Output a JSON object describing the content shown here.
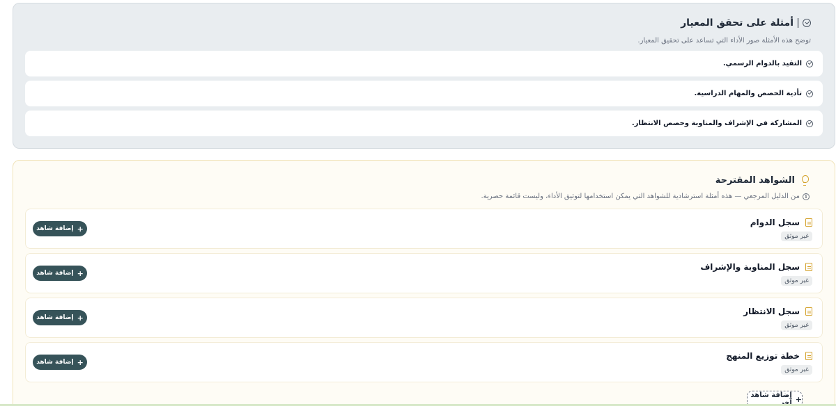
{
  "examples": {
    "title": "أمثلة على تحقق المعيار",
    "description": "توضح هذه الأمثلة صور الأداء التي تساعد على تحقيق المعيار.",
    "items": [
      {
        "label": "التقيد بالدوام الرسمي."
      },
      {
        "label": "تأدية الحصص والمهام الدراسية."
      },
      {
        "label": "المشاركة في الإشراف والمناوبة وحصص الانتظار."
      }
    ]
  },
  "evidence": {
    "title": "الشواهد المقترحة",
    "description": "من الدليل المرجعي — هذه أمثلة استرشادية للشواهد التي يمكن استخدامها لتوثيق الأداء، وليست قائمة حصرية.",
    "items": [
      {
        "name": "سجل الدوام",
        "status": "غير موثق",
        "button": "إضافة شاهد"
      },
      {
        "name": "سجل المناوبة والإشراف",
        "status": "غير موثق",
        "button": "إضافة شاهد"
      },
      {
        "name": "سجل الانتظار",
        "status": "غير موثق",
        "button": "إضافة شاهد"
      },
      {
        "name": "خطة توزيع المنهج",
        "status": "غير موثق",
        "button": "إضافة شاهد"
      }
    ],
    "add_other": "إضافة شاهد آخر"
  },
  "icons": {
    "check": "circle-check-icon",
    "bulb": "lightbulb-icon",
    "info": "info-icon",
    "doc": "document-icon",
    "plus": "plus-icon"
  },
  "colors": {
    "button": "#365359",
    "accent": "#d4a22c",
    "examples_bg": "#e9edf0",
    "evidence_bg": "#fefcf5"
  }
}
